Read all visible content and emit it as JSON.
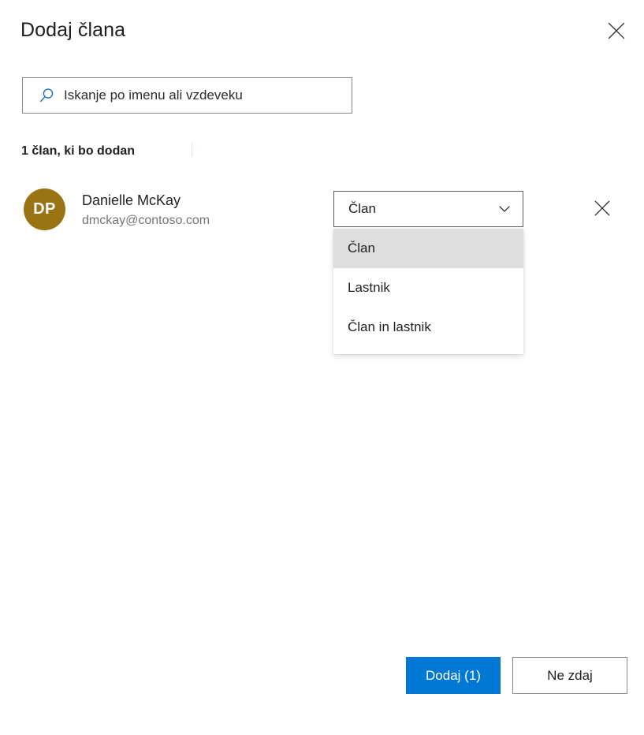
{
  "dialog": {
    "title": "Dodaj člana",
    "close_label": "Zapri",
    "close_icon": "close-icon"
  },
  "search": {
    "placeholder": "Iskanje po imenu ali vzdeveku",
    "value": "",
    "icon": "search-icon"
  },
  "summary": {
    "count_text": "1 član, ki bo dodan"
  },
  "member": {
    "initials": "DP",
    "avatar_color": "#9a7312",
    "name": "Danielle McKay",
    "email": "dmckay@contoso.com",
    "remove_label": "Odstrani",
    "remove_icon": "close-icon"
  },
  "role_select": {
    "selected": "Član",
    "chevron_icon": "chevron-down-icon",
    "options": [
      {
        "label": "Član",
        "selected": true
      },
      {
        "label": "Lastnik",
        "selected": false
      },
      {
        "label": "Član in lastnik",
        "selected": false
      }
    ]
  },
  "footer": {
    "primary_label": "Dodaj (1)",
    "secondary_label": "Ne zdaj"
  },
  "colors": {
    "accent": "#0078d4",
    "avatar": "#9a7312",
    "highlight": "#dedede",
    "border": "#8a8886",
    "text": "#201f1e",
    "muted_text": "#757575"
  }
}
